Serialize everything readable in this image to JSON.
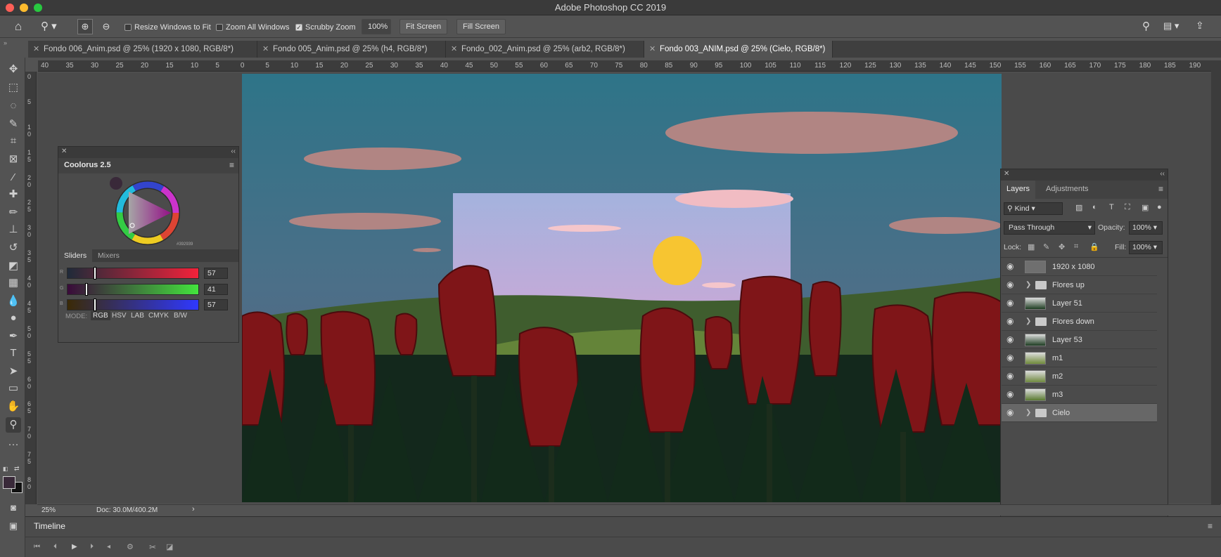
{
  "app": {
    "title": "Adobe Photoshop CC 2019"
  },
  "options_bar": {
    "resize_windows": "Resize Windows to Fit",
    "zoom_all": "Zoom All Windows",
    "scrubby_zoom": "Scrubby Zoom",
    "zoom_value": "100%",
    "fit_screen": "Fit Screen",
    "fill_screen": "Fill Screen"
  },
  "tabs": [
    {
      "label": "Fondo 006_Anim.psd @ 25% (1920 x 1080, RGB/8*)"
    },
    {
      "label": "Fondo 005_Anim.psd @ 25% (h4, RGB/8*)"
    },
    {
      "label": "Fondo_002_Anim.psd @ 25% (arb2, RGB/8*)"
    },
    {
      "label": "Fondo 003_ANIM.psd @ 25% (Cielo, RGB/8*)"
    }
  ],
  "ruler": {
    "h_labels": [
      "40",
      "35",
      "30",
      "25",
      "20",
      "15",
      "10",
      "5",
      "0",
      "5",
      "10",
      "15",
      "20",
      "25",
      "30",
      "35",
      "40",
      "45",
      "50",
      "55",
      "60",
      "65",
      "70",
      "75",
      "80",
      "85",
      "90",
      "95",
      "100",
      "105",
      "110",
      "115",
      "120",
      "125",
      "130",
      "135",
      "140",
      "145",
      "150",
      "155",
      "160",
      "165",
      "170",
      "175",
      "180",
      "185",
      "190"
    ],
    "v_labels": [
      "0",
      "5",
      "1 0",
      "1 5",
      "2 0",
      "2 5",
      "3 0",
      "3 5",
      "4 0",
      "4 5",
      "5 0",
      "5 5",
      "6 0",
      "6 5",
      "7 0",
      "7 5",
      "8 0"
    ]
  },
  "coolorus": {
    "title": "Coolorus 2.5",
    "tabs": {
      "sliders": "Sliders",
      "mixers": "Mixers"
    },
    "sliders": [
      {
        "channel": "R",
        "value": "57"
      },
      {
        "channel": "G",
        "value": "41"
      },
      {
        "channel": "B",
        "value": "57"
      }
    ],
    "mode_label": "MODE:",
    "modes": [
      "RGB",
      "HSV",
      "LAB",
      "CMYK",
      "B/W"
    ],
    "active_mode": "RGB",
    "hex": "#392939"
  },
  "layers_panel": {
    "tabs": {
      "layers": "Layers",
      "adjustments": "Adjustments"
    },
    "filter_kind": "Kind",
    "blend_mode": "Pass Through",
    "opacity_label": "Opacity:",
    "opacity": "100%",
    "lock_label": "Lock:",
    "fill_label": "Fill:",
    "fill": "100%",
    "layers": [
      {
        "name": "1920 x 1080",
        "type": "layer"
      },
      {
        "name": "Flores up",
        "type": "group"
      },
      {
        "name": "Layer 51",
        "type": "layer"
      },
      {
        "name": "Flores down",
        "type": "group"
      },
      {
        "name": "Layer 53",
        "type": "layer"
      },
      {
        "name": "m1",
        "type": "layer"
      },
      {
        "name": "m2",
        "type": "layer"
      },
      {
        "name": "m3",
        "type": "layer"
      },
      {
        "name": "Cielo",
        "type": "group",
        "selected": true
      }
    ]
  },
  "status": {
    "zoom": "25%",
    "doc": "Doc: 30.0M/400.2M"
  },
  "timeline": {
    "title": "Timeline"
  },
  "colors": {
    "foreground": "#392939",
    "accent": "#2f80ed"
  }
}
